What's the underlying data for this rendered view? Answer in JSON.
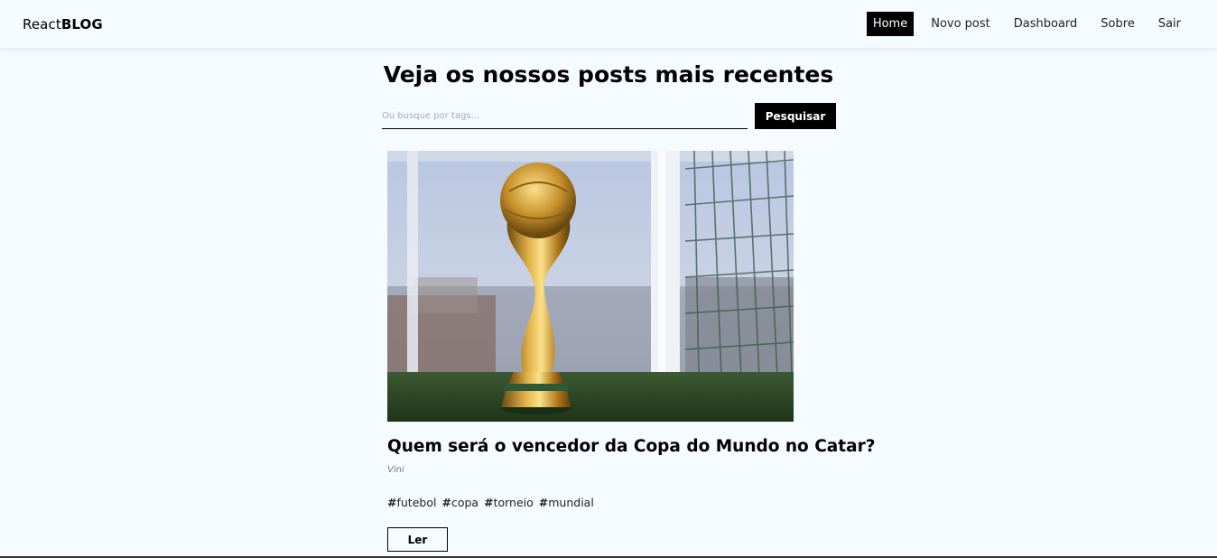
{
  "navbar": {
    "brand_light": "React",
    "brand_bold": "BLOG",
    "links": [
      {
        "label": "Home",
        "active": true
      },
      {
        "label": "Novo post",
        "active": false
      },
      {
        "label": "Dashboard",
        "active": false
      },
      {
        "label": "Sobre",
        "active": false
      }
    ],
    "logout_label": "Sair"
  },
  "main": {
    "title": "Veja os nossos posts mais recentes",
    "search": {
      "placeholder": "Ou busque por tags...",
      "value": "",
      "button_label": "Pesquisar"
    }
  },
  "post": {
    "title": "Quem será o vencedor da Copa do Mundo no Catar?",
    "author": "Vini",
    "tags": [
      "futebol",
      "copa",
      "torneio",
      "mundial"
    ],
    "read_label": "Ler"
  },
  "colors": {
    "background": "#f6fbff",
    "accent": "#000000"
  }
}
